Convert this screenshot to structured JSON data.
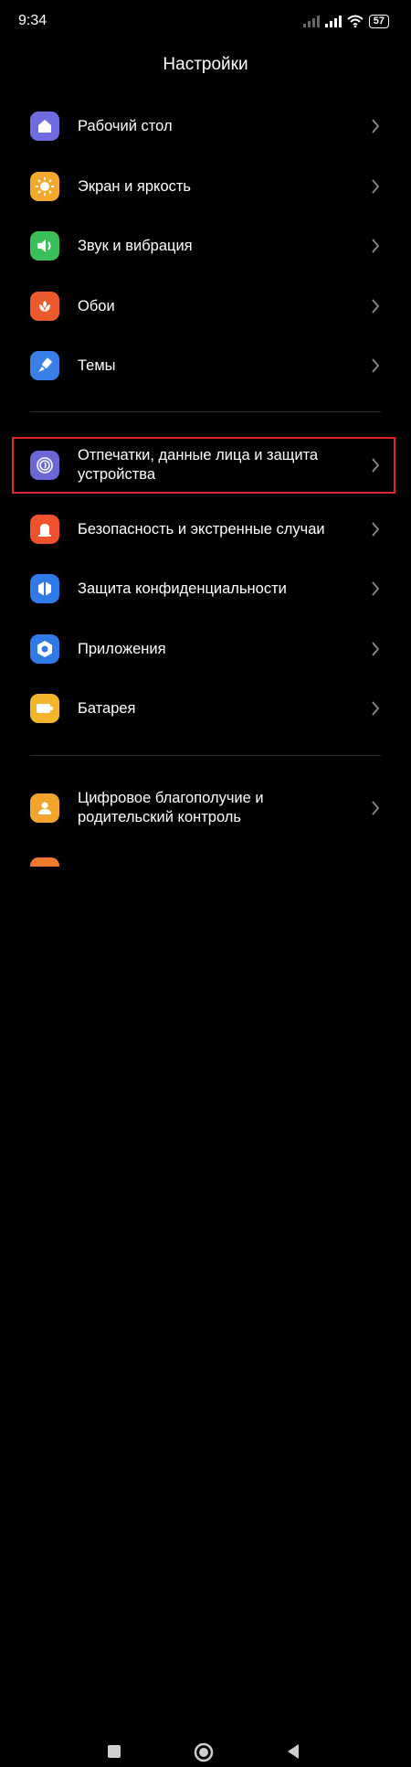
{
  "status_bar": {
    "time": "9:34",
    "battery": "57"
  },
  "header": {
    "title": "Настройки"
  },
  "colors": {
    "home": "#6f6be0",
    "display": "#f2a82c",
    "sound": "#3bbf58",
    "wallpaper": "#ec5a2c",
    "themes": "#3a7ee8",
    "fingerprint": "#6a68d8",
    "safety": "#f0522e",
    "privacy": "#2f7ae6",
    "apps": "#2f7ae6",
    "battery": "#f2b52c",
    "wellbeing": "#f2a42c",
    "highlight": "#e0262c"
  },
  "settings": {
    "items": [
      {
        "label": "Рабочий стол",
        "icon": "home-icon"
      },
      {
        "label": "Экран и яркость",
        "icon": "sun-icon"
      },
      {
        "label": "Звук и вибрация",
        "icon": "speaker-icon"
      },
      {
        "label": "Обои",
        "icon": "flower-icon"
      },
      {
        "label": "Темы",
        "icon": "brush-icon"
      },
      {
        "label": "Отпечатки, данные лица и защита устройства",
        "icon": "fingerprint-icon"
      },
      {
        "label": "Безопасность и экстренные случаи",
        "icon": "alarm-icon"
      },
      {
        "label": "Защита конфиденциальности",
        "icon": "shield-icon"
      },
      {
        "label": "Приложения",
        "icon": "gear-icon"
      },
      {
        "label": "Батарея",
        "icon": "battery-icon"
      },
      {
        "label": "Цифровое благополучие и родительский контроль",
        "icon": "person-icon"
      }
    ]
  },
  "nav": {
    "buttons": [
      "recents-button",
      "home-button",
      "back-button"
    ]
  }
}
